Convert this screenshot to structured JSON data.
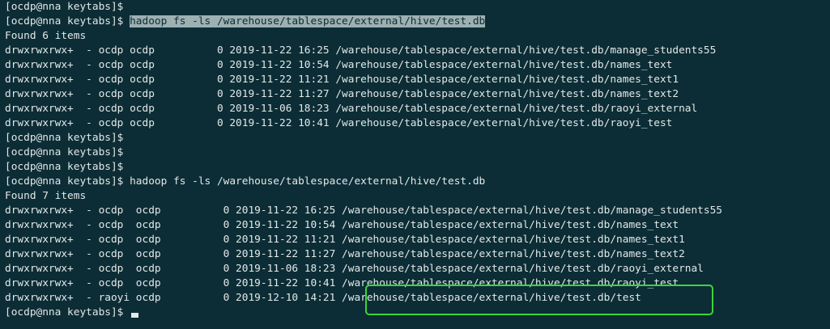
{
  "terminal": {
    "lines": [
      {
        "text": "[ocdp@nna keytabs]$"
      },
      {
        "prompt": "[ocdp@nna keytabs]$ ",
        "command": "hadoop fs -ls /warehouse/tablespace/external/hive/test.db"
      },
      {
        "text": "Found 6 items"
      },
      {
        "text": "drwxrwxrwx+  - ocdp ocdp          0 2019-11-22 16:25 /warehouse/tablespace/external/hive/test.db/manage_students55"
      },
      {
        "text": "drwxrwxrwx+  - ocdp ocdp          0 2019-11-22 10:54 /warehouse/tablespace/external/hive/test.db/names_text"
      },
      {
        "text": "drwxrwxrwx+  - ocdp ocdp          0 2019-11-22 11:21 /warehouse/tablespace/external/hive/test.db/names_text1"
      },
      {
        "text": "drwxrwxrwx+  - ocdp ocdp          0 2019-11-22 11:27 /warehouse/tablespace/external/hive/test.db/names_text2"
      },
      {
        "text": "drwxrwxrwx+  - ocdp ocdp          0 2019-11-06 18:23 /warehouse/tablespace/external/hive/test.db/raoyi_external"
      },
      {
        "text": "drwxrwxrwx+  - ocdp ocdp          0 2019-11-22 10:41 /warehouse/tablespace/external/hive/test.db/raoyi_test"
      },
      {
        "text": "[ocdp@nna keytabs]$"
      },
      {
        "text": "[ocdp@nna keytabs]$"
      },
      {
        "text": "[ocdp@nna keytabs]$"
      },
      {
        "text": "[ocdp@nna keytabs]$ hadoop fs -ls /warehouse/tablespace/external/hive/test.db"
      },
      {
        "text": "Found 7 items"
      },
      {
        "text": "drwxrwxrwx+  - ocdp  ocdp          0 2019-11-22 16:25 /warehouse/tablespace/external/hive/test.db/manage_students55"
      },
      {
        "text": "drwxrwxrwx+  - ocdp  ocdp          0 2019-11-22 10:54 /warehouse/tablespace/external/hive/test.db/names_text"
      },
      {
        "text": "drwxrwxrwx+  - ocdp  ocdp          0 2019-11-22 11:21 /warehouse/tablespace/external/hive/test.db/names_text1"
      },
      {
        "text": "drwxrwxrwx+  - ocdp  ocdp          0 2019-11-22 11:27 /warehouse/tablespace/external/hive/test.db/names_text2"
      },
      {
        "text": "drwxrwxrwx+  - ocdp  ocdp          0 2019-11-06 18:23 /warehouse/tablespace/external/hive/test.db/raoyi_external"
      },
      {
        "text": "drwxrwxrwx+  - ocdp  ocdp          0 2019-11-22 10:41 /warehouse/tablespace/external/hive/test.db/raoyi_test"
      },
      {
        "text": "drwxrwxrwx+  - raoyi ocdp          0 2019-12-10 14:21 /warehouse/tablespace/external/hive/test.db/test"
      },
      {
        "prompt": "[ocdp@nna keytabs]$ ",
        "cursor": true
      }
    ]
  },
  "colors": {
    "background": "#0c2d36",
    "foreground": "#e3e8e8",
    "selection": "#9db0b2",
    "annotation": "#3ed43a"
  }
}
